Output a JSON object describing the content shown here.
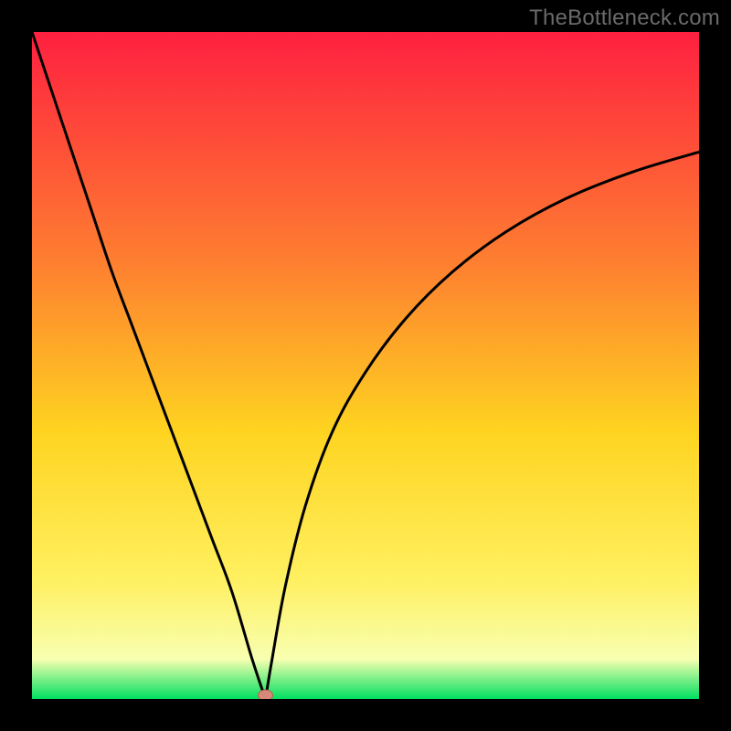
{
  "watermark": "TheBottleneck.com",
  "colors": {
    "gradient_top": "#fe2040",
    "gradient_q1": "#fe8030",
    "gradient_mid": "#fed420",
    "gradient_q3": "#fff060",
    "gradient_lower": "#f8ffb0",
    "gradient_bottom": "#00e060",
    "curve": "#000000",
    "marker_fill": "#d88878",
    "marker_stroke": "#b06050",
    "background": "#000000"
  },
  "chart_data": {
    "type": "line",
    "title": "",
    "xlabel": "",
    "ylabel": "",
    "xlim": [
      0,
      100
    ],
    "ylim": [
      0,
      100
    ],
    "left_branch": {
      "x": [
        0,
        3,
        6,
        9,
        12,
        15,
        18,
        21,
        24,
        27,
        30,
        33,
        35
      ],
      "y": [
        100,
        91,
        82,
        73,
        64,
        56,
        48,
        40,
        32,
        24,
        16,
        6,
        0
      ]
    },
    "right_branch": {
      "x": [
        35,
        36,
        38,
        41,
        45,
        50,
        56,
        63,
        71,
        80,
        90,
        100
      ],
      "y": [
        0,
        6,
        17,
        29,
        40,
        49,
        57,
        64,
        70,
        75,
        79,
        82
      ]
    },
    "marker": {
      "x": 35,
      "y": 0
    }
  }
}
